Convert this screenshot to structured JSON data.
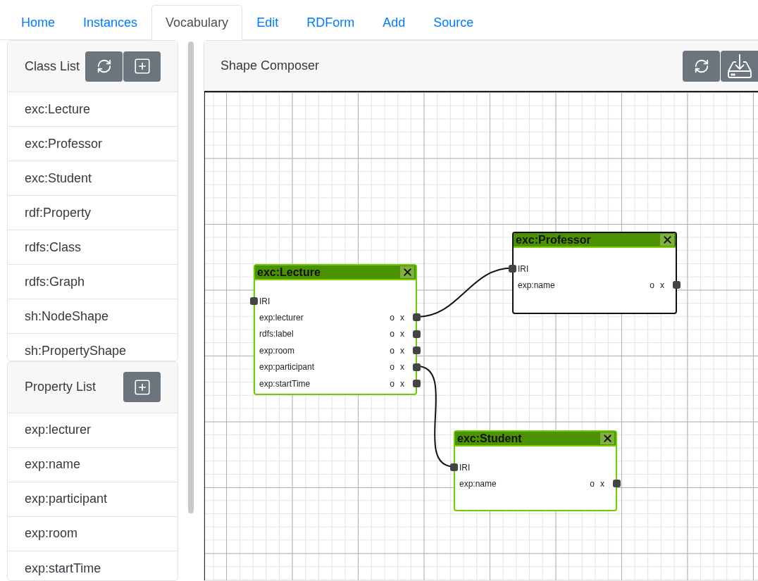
{
  "tabs": [
    {
      "label": "Home",
      "selected": false
    },
    {
      "label": "Instances",
      "selected": false
    },
    {
      "label": "Vocabulary",
      "selected": true
    },
    {
      "label": "Edit",
      "selected": false
    },
    {
      "label": "RDForm",
      "selected": false
    },
    {
      "label": "Add",
      "selected": false
    },
    {
      "label": "Source",
      "selected": false
    }
  ],
  "class_list": {
    "title": "Class List",
    "items": [
      "exc:Lecture",
      "exc:Professor",
      "exc:Student",
      "rdf:Property",
      "rdfs:Class",
      "rdfs:Graph",
      "sh:NodeShape",
      "sh:PropertyShape"
    ]
  },
  "property_list": {
    "title": "Property List",
    "items": [
      "exp:lecturer",
      "exp:name",
      "exp:participant",
      "exp:room",
      "exp:startTime"
    ]
  },
  "shape_composer": {
    "title": "Shape Composer",
    "nodes": [
      {
        "title": "exc:Lecture",
        "selected": false,
        "id_label": "IRI",
        "properties": [
          {
            "name": "exp:lecturer",
            "optional": "o",
            "remove": "x"
          },
          {
            "name": "rdfs:label",
            "optional": "o",
            "remove": "x"
          },
          {
            "name": "exp:room",
            "optional": "o",
            "remove": "x"
          },
          {
            "name": "exp:participant",
            "optional": "o",
            "remove": "x"
          },
          {
            "name": "exp:startTime",
            "optional": "o",
            "remove": "x"
          }
        ]
      },
      {
        "title": "exc:Professor",
        "selected": true,
        "id_label": "IRI",
        "properties": [
          {
            "name": "exp:name",
            "optional": "o",
            "remove": "x"
          }
        ]
      },
      {
        "title": "exc:Student",
        "selected": false,
        "id_label": "IRI",
        "properties": [
          {
            "name": "exp:name",
            "optional": "o",
            "remove": "x"
          }
        ]
      }
    ]
  }
}
